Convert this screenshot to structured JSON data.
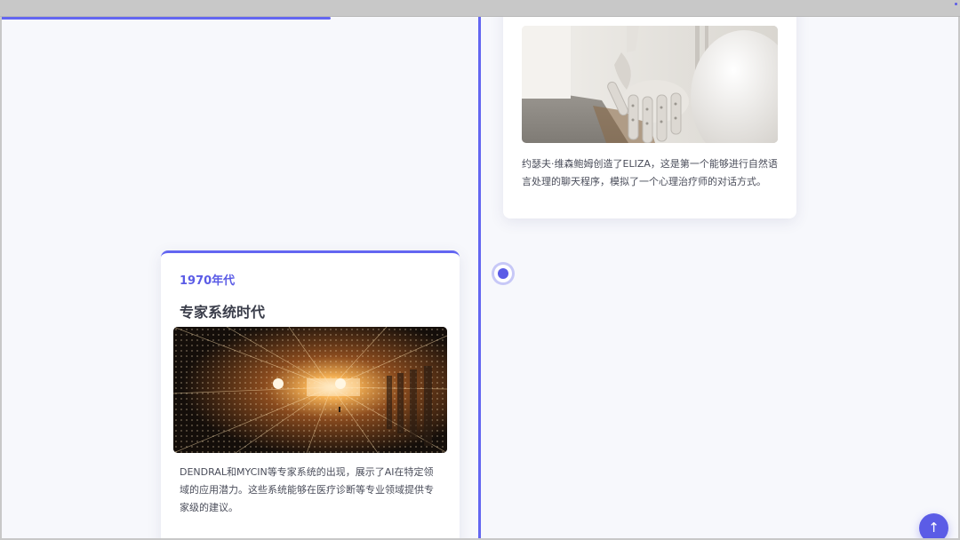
{
  "colors": {
    "accent": "#6366f1",
    "accent_dark": "#5b5ce6",
    "page_background": "#f7f8fc",
    "card_background": "#ffffff",
    "text": "#4a4d5a"
  },
  "scroll_progress": 0.34,
  "timeline": {
    "events": [
      {
        "id": "eliza",
        "image_icon": "robot-hand-image",
        "description": "约瑟夫·维森鲍姆创造了ELIZA，这是第一个能够进行自然语言处理的聊天程序，模拟了一个心理治疗师的对话方式。"
      },
      {
        "id": "expert-systems",
        "date": "1970年代",
        "title": "专家系统时代",
        "image_icon": "light-tunnel-image",
        "description": "DENDRAL和MYCIN等专家系统的出现，展示了AI在特定领域的应用潜力。这些系统能够在医疗诊断等专业领域提供专家级的建议。"
      }
    ]
  },
  "back_to_top": {
    "icon": "arrow-up-icon",
    "glyph": "↑"
  }
}
